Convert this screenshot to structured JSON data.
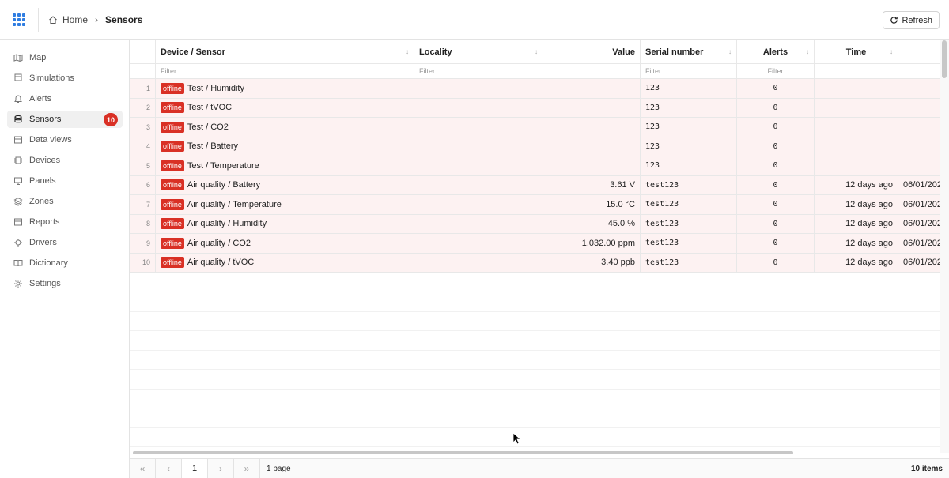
{
  "breadcrumb": {
    "home": "Home",
    "current": "Sensors"
  },
  "toolbar": {
    "refresh_label": "Refresh"
  },
  "sidebar": {
    "items": [
      {
        "label": "Map",
        "icon": "map-icon"
      },
      {
        "label": "Simulations",
        "icon": "flask-icon"
      },
      {
        "label": "Alerts",
        "icon": "bell-icon"
      },
      {
        "label": "Sensors",
        "icon": "database-icon",
        "badge": "10",
        "active": true
      },
      {
        "label": "Data views",
        "icon": "table-icon"
      },
      {
        "label": "Devices",
        "icon": "chip-icon"
      },
      {
        "label": "Panels",
        "icon": "monitor-icon"
      },
      {
        "label": "Zones",
        "icon": "layers-icon"
      },
      {
        "label": "Reports",
        "icon": "chart-icon"
      },
      {
        "label": "Drivers",
        "icon": "cpu-icon"
      },
      {
        "label": "Dictionary",
        "icon": "book-icon"
      },
      {
        "label": "Settings",
        "icon": "gear-icon"
      }
    ]
  },
  "table": {
    "columns": [
      "Device / Sensor",
      "Locality",
      "Value",
      "Serial number",
      "Alerts",
      "Time",
      ""
    ],
    "filter_placeholder": "Filter",
    "status_label": "offline",
    "rows": [
      {
        "num": "1",
        "sensor": "Test / Humidity",
        "locality": "",
        "value": "",
        "serial": "123",
        "alerts": "0",
        "time": "",
        "date": ""
      },
      {
        "num": "2",
        "sensor": "Test / tVOC",
        "locality": "",
        "value": "",
        "serial": "123",
        "alerts": "0",
        "time": "",
        "date": ""
      },
      {
        "num": "3",
        "sensor": "Test / CO2",
        "locality": "",
        "value": "",
        "serial": "123",
        "alerts": "0",
        "time": "",
        "date": ""
      },
      {
        "num": "4",
        "sensor": "Test / Battery",
        "locality": "",
        "value": "",
        "serial": "123",
        "alerts": "0",
        "time": "",
        "date": ""
      },
      {
        "num": "5",
        "sensor": "Test / Temperature",
        "locality": "",
        "value": "",
        "serial": "123",
        "alerts": "0",
        "time": "",
        "date": ""
      },
      {
        "num": "6",
        "sensor": "Air quality / Battery",
        "locality": "",
        "value": "3.61 V",
        "serial": "test123",
        "alerts": "0",
        "time": "12 days ago",
        "date": "06/01/202"
      },
      {
        "num": "7",
        "sensor": "Air quality / Temperature",
        "locality": "",
        "value": "15.0 °C",
        "serial": "test123",
        "alerts": "0",
        "time": "12 days ago",
        "date": "06/01/202"
      },
      {
        "num": "8",
        "sensor": "Air quality / Humidity",
        "locality": "",
        "value": "45.0 %",
        "serial": "test123",
        "alerts": "0",
        "time": "12 days ago",
        "date": "06/01/202"
      },
      {
        "num": "9",
        "sensor": "Air quality / CO2",
        "locality": "",
        "value": "1,032.00 ppm",
        "serial": "test123",
        "alerts": "0",
        "time": "12 days ago",
        "date": "06/01/202"
      },
      {
        "num": "10",
        "sensor": "Air quality / tVOC",
        "locality": "",
        "value": "3.40 ppb",
        "serial": "test123",
        "alerts": "0",
        "time": "12 days ago",
        "date": "06/01/202"
      }
    ]
  },
  "pagination": {
    "current_page": "1",
    "pages_text": "1 page",
    "items_text": "10 items"
  },
  "colors": {
    "accent": "#2f7de1",
    "status": "#d93025",
    "row_tint": "#fdf2f2"
  }
}
